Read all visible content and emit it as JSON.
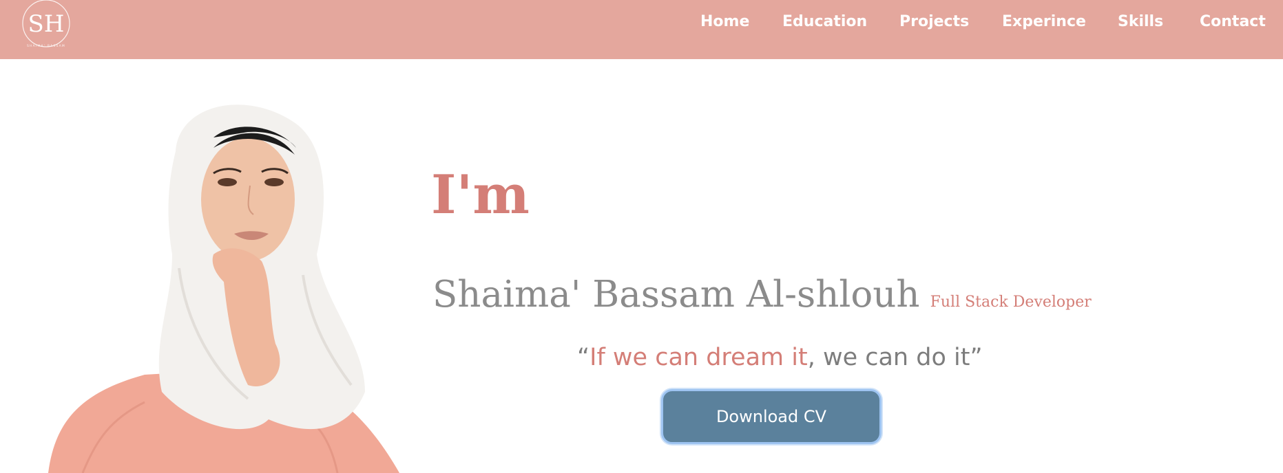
{
  "brand": {
    "logo_text": "SH",
    "logo_ring_text": "SHAIMA' BASSAM",
    "colors": {
      "navbar": "#e4a79d",
      "accent": "#d47e77",
      "gray_text": "#8b8b8b",
      "button": "#5b819c"
    }
  },
  "nav": {
    "items": [
      {
        "label": "Home"
      },
      {
        "label": "Education"
      },
      {
        "label": "Projects"
      },
      {
        "label": "Experince"
      },
      {
        "label": "Skills"
      },
      {
        "label": "Contact"
      }
    ]
  },
  "hero": {
    "greeting": "I'm",
    "name": "Shaima' Bassam Al-shlouh",
    "role": "Full Stack Developer",
    "quote": {
      "open": "“",
      "accent": "If we can dream it",
      "rest": ", we can do it",
      "close": "”"
    },
    "download_label": "Download CV"
  },
  "portrait": {
    "icon": "person-portrait-image"
  }
}
